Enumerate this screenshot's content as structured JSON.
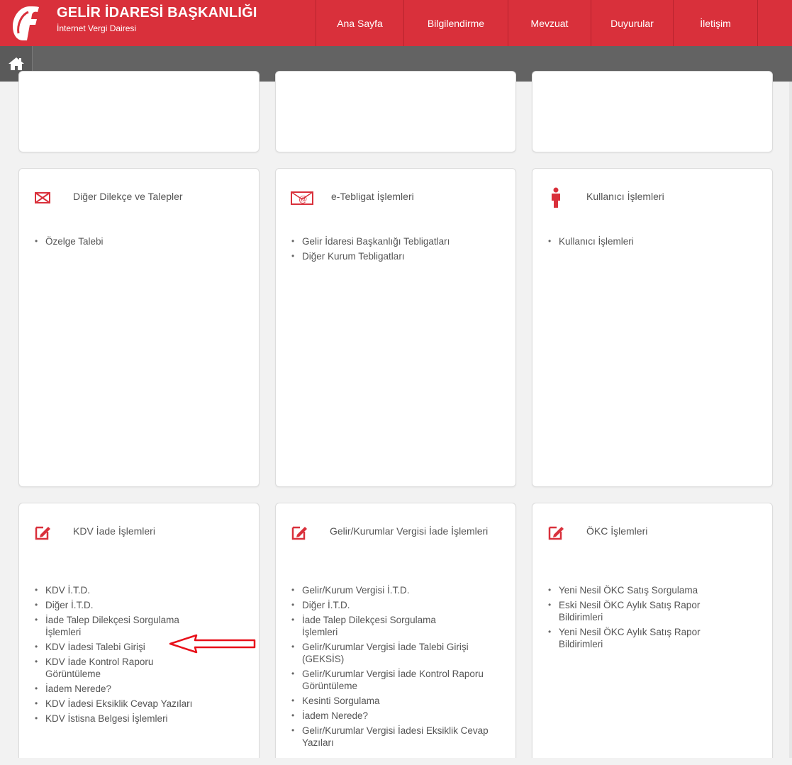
{
  "header": {
    "title": "GELİR İDARESİ BAŞKANLIĞI",
    "subtitle": "İnternet Vergi Dairesi",
    "nav": [
      {
        "label": "Ana Sayfa",
        "w": 124
      },
      {
        "label": "Bilgilendirme",
        "w": 147
      },
      {
        "label": "Mevzuat",
        "w": 117
      },
      {
        "label": "Duyurular",
        "w": 116
      },
      {
        "label": "İletişim",
        "w": 120
      }
    ],
    "colors": {
      "brand": "#d9303b",
      "subbar": "#636363"
    }
  },
  "cards": [
    {
      "title": "",
      "icon": "none",
      "items": []
    },
    {
      "title": "",
      "icon": "none",
      "items": []
    },
    {
      "title": "",
      "icon": "none",
      "items": []
    },
    {
      "title": "Diğer Dilekçe ve Talepler",
      "icon": "envelope-icon",
      "items": [
        "Özelge Talebi"
      ]
    },
    {
      "title": "e-Tebligat İşlemleri",
      "icon": "e-envelope-icon",
      "items": [
        "Gelir İdaresi Başkanlığı Tebligatları",
        "Diğer Kurum Tebligatları"
      ]
    },
    {
      "title": "Kullanıcı İşlemleri",
      "icon": "user-icon",
      "items": [
        "Kullanıcı İşlemleri"
      ]
    },
    {
      "title": "KDV İade İşlemleri",
      "icon": "edit-icon",
      "items": [
        "KDV İ.T.D.",
        "Diğer İ.T.D.",
        "İade Talep Dilekçesi Sorgulama İşlemleri",
        "KDV İadesi Talebi Girişi",
        "KDV İade Kontrol Raporu Görüntüleme",
        "İadem Nerede?",
        "KDV İadesi Eksiklik Cevap Yazıları",
        "KDV İstisna Belgesi İşlemleri"
      ]
    },
    {
      "title": "Gelir/Kurumlar Vergisi İade İşlemleri",
      "icon": "edit-icon",
      "items": [
        "Gelir/Kurum Vergisi İ.T.D.",
        "Diğer İ.T.D.",
        "İade Talep Dilekçesi Sorgulama İşlemleri",
        "Gelir/Kurumlar Vergisi İade Talebi Girişi (GEKSİS)",
        "Gelir/Kurumlar Vergisi İade Kontrol Raporu Görüntüleme",
        "Kesinti Sorgulama",
        "İadem Nerede?",
        "Gelir/Kurumlar Vergisi İadesi Eksiklik Cevap Yazıları"
      ]
    },
    {
      "title": "ÖKC İşlemleri",
      "icon": "edit-icon",
      "items": [
        "Yeni Nesil ÖKC Satış Sorgulama",
        "Eski Nesil ÖKC Aylık Satış Rapor Bildirimleri",
        "Yeni Nesil ÖKC Aylık Satış Rapor Bildirimleri"
      ]
    }
  ]
}
